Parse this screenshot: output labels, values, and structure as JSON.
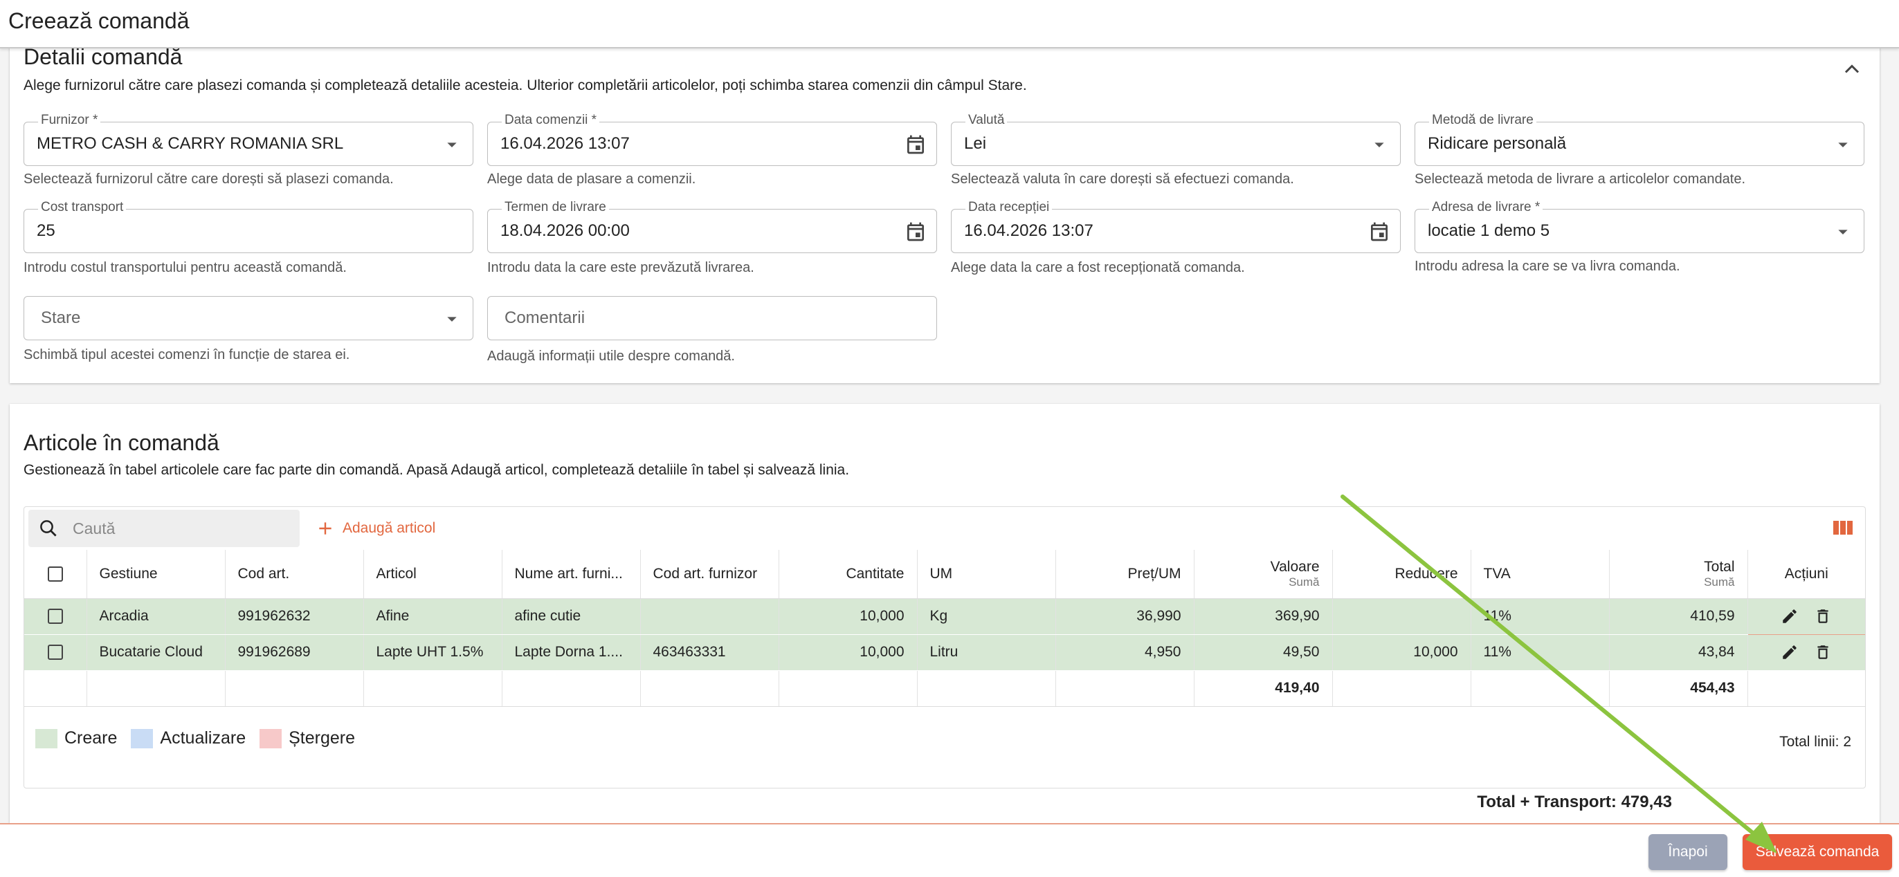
{
  "page": {
    "title": "Creează comandă"
  },
  "details": {
    "title": "Detalii comandă",
    "subtitle": "Alege furnizorul către care plasezi comanda și completează detaliile acesteia. Ulterior completării articolelor, poți schimba starea comenzii din câmpul Stare.",
    "fields": {
      "supplier": {
        "label": "Furnizor *",
        "value": "METRO CASH & CARRY ROMANIA SRL",
        "helper": "Selectează furnizorul către care dorești să plasezi comanda."
      },
      "order_date": {
        "label": "Data comenzii *",
        "value": "16.04.2026 13:07",
        "helper": "Alege data de plasare a comenzii."
      },
      "currency": {
        "label": "Valută",
        "value": "Lei",
        "helper": "Selectează valuta în care dorești să efectuezi comanda."
      },
      "delivery_method": {
        "label": "Metodă de livrare",
        "value": "Ridicare personală",
        "helper": "Selectează metoda de livrare a articolelor comandate."
      },
      "transport_cost": {
        "label": "Cost transport",
        "value": "25",
        "helper": "Introdu costul transportului pentru această comandă."
      },
      "delivery_term": {
        "label": "Termen de livrare",
        "value": "18.04.2026 00:00",
        "helper": "Introdu data la care este prevăzută livrarea."
      },
      "reception_date": {
        "label": "Data recepției",
        "value": "16.04.2026 13:07",
        "helper": "Alege data la care a fost recepționată comanda."
      },
      "delivery_address": {
        "label": "Adresa de livrare *",
        "value": "locatie 1 demo 5",
        "helper": "Introdu adresa la care se va livra comanda."
      },
      "status": {
        "placeholder": "Stare",
        "helper": "Schimbă tipul acestei comenzi în funcție de starea ei."
      },
      "comments": {
        "placeholder": "Comentarii",
        "helper": "Adaugă informații utile despre comandă."
      }
    }
  },
  "items": {
    "title": "Articole în comandă",
    "subtitle": "Gestionează în tabel articolele care fac parte din comandă. Apasă Adaugă articol, completează detaliile în tabel și salvează linia.",
    "search_placeholder": "Caută",
    "add_label": "Adaugă articol",
    "columns": {
      "gestiune": "Gestiune",
      "cod_art": "Cod art.",
      "articol": "Articol",
      "nume_furn": "Nume art. furni...",
      "cod_furn": "Cod art. furnizor",
      "cantitate": "Cantitate",
      "um": "UM",
      "pret": "Preț/UM",
      "valoare": "Valoare",
      "valoare_sub": "Sumă",
      "reducere": "Reducere",
      "tva": "TVA",
      "total": "Total",
      "total_sub": "Sumă",
      "actiuni": "Acțiuni"
    },
    "rows": [
      {
        "gestiune": "Arcadia",
        "cod_art": "991962632",
        "articol": "Afine",
        "nume_furn": "afine cutie",
        "cod_furn": "",
        "cantitate": "10,000",
        "um": "Kg",
        "pret": "36,990",
        "valoare": "369,90",
        "reducere": "",
        "tva": "11%",
        "total": "410,59"
      },
      {
        "gestiune": "Bucatarie Cloud",
        "cod_art": "991962689",
        "articol": "Lapte UHT 1.5%",
        "nume_furn": "Lapte Dorna 1....",
        "cod_furn": "463463331",
        "cantitate": "10,000",
        "um": "Litru",
        "pret": "4,950",
        "valoare": "49,50",
        "reducere": "10,000",
        "tva": "11%",
        "total": "43,84"
      }
    ],
    "totals": {
      "valoare": "419,40",
      "total": "454,43"
    },
    "legend": {
      "create": "Creare",
      "update": "Actualizare",
      "delete": "Ștergere"
    },
    "total_lines": "Total linii: 2",
    "grand_total": "Total + Transport: 479,43"
  },
  "footer": {
    "back_label": "Înapoi",
    "save_label": "Salvează comanda"
  },
  "colors": {
    "accent": "#ea5b3c",
    "created_row": "#d7e8d4",
    "update": "#c9dcf5",
    "delete": "#f7c9c9",
    "back_button": "#9ba3b6",
    "arrow": "#8cc43f"
  }
}
